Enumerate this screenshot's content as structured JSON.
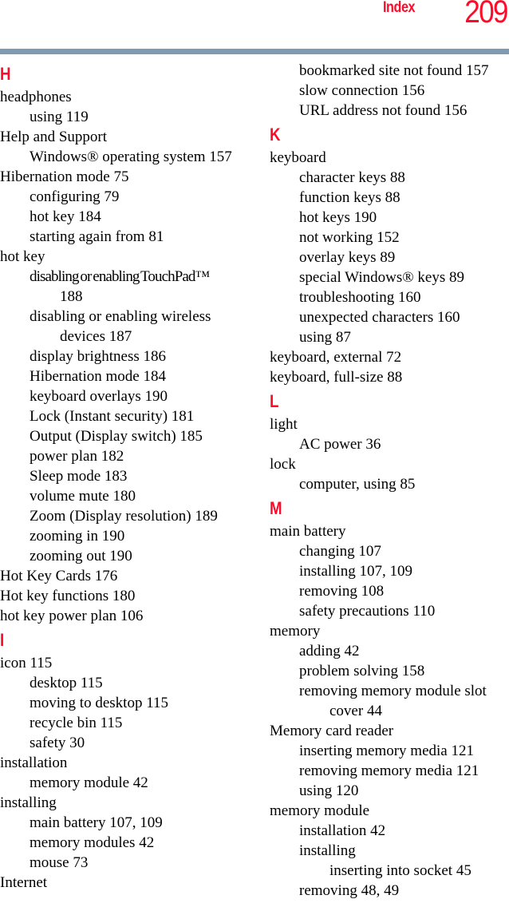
{
  "header": {
    "section": "Index",
    "page_number": "209",
    "rule_color": "#7f9bb4",
    "accent_color": "#ff0a28"
  },
  "columns": [
    {
      "entries": [
        {
          "type": "letter",
          "text": "H"
        },
        {
          "level": 0,
          "text": "headphones"
        },
        {
          "level": 1,
          "text": "using 119"
        },
        {
          "level": 0,
          "text": "Help and Support"
        },
        {
          "level": 1,
          "text": "Windows® operating system 157"
        },
        {
          "level": 0,
          "text": "Hibernation mode 75"
        },
        {
          "level": 1,
          "text": "configuring 79"
        },
        {
          "level": 1,
          "text": "hot key 184"
        },
        {
          "level": 1,
          "text": "starting again from 81"
        },
        {
          "level": 0,
          "text": "hot key"
        },
        {
          "level": 1,
          "text": "disabling or enabling TouchPad™",
          "condensed": true
        },
        {
          "level": 2,
          "text": "188"
        },
        {
          "level": 1,
          "text": "disabling or enabling wireless"
        },
        {
          "level": 2,
          "text": "devices 187"
        },
        {
          "level": 1,
          "text": "display brightness 186"
        },
        {
          "level": 1,
          "text": "Hibernation mode 184"
        },
        {
          "level": 1,
          "text": "keyboard overlays 190"
        },
        {
          "level": 1,
          "text": "Lock (Instant security) 181"
        },
        {
          "level": 1,
          "text": "Output (Display switch) 185"
        },
        {
          "level": 1,
          "text": "power plan 182"
        },
        {
          "level": 1,
          "text": "Sleep mode 183"
        },
        {
          "level": 1,
          "text": "volume mute 180"
        },
        {
          "level": 1,
          "text": "Zoom (Display resolution) 189"
        },
        {
          "level": 1,
          "text": "zooming in 190"
        },
        {
          "level": 1,
          "text": "zooming out 190"
        },
        {
          "level": 0,
          "text": "Hot Key Cards 176"
        },
        {
          "level": 0,
          "text": "Hot key functions 180"
        },
        {
          "level": 0,
          "text": "hot key power plan 106"
        },
        {
          "type": "letter",
          "text": "I"
        },
        {
          "level": 0,
          "text": "icon 115"
        },
        {
          "level": 1,
          "text": "desktop 115"
        },
        {
          "level": 1,
          "text": "moving to desktop 115"
        },
        {
          "level": 1,
          "text": "recycle bin 115"
        },
        {
          "level": 1,
          "text": "safety 30"
        },
        {
          "level": 0,
          "text": "installation"
        },
        {
          "level": 1,
          "text": "memory module 42"
        },
        {
          "level": 0,
          "text": "installing"
        },
        {
          "level": 1,
          "text": "main battery 107, 109"
        },
        {
          "level": 1,
          "text": "memory modules 42"
        },
        {
          "level": 1,
          "text": "mouse 73"
        },
        {
          "level": 0,
          "text": "Internet"
        }
      ]
    },
    {
      "entries": [
        {
          "level": 1,
          "text": "bookmarked site not found 157"
        },
        {
          "level": 1,
          "text": "slow connection 156"
        },
        {
          "level": 1,
          "text": "URL address not found 156"
        },
        {
          "type": "letter",
          "text": "K"
        },
        {
          "level": 0,
          "text": "keyboard"
        },
        {
          "level": 1,
          "text": "character keys 88"
        },
        {
          "level": 1,
          "text": "function keys 88"
        },
        {
          "level": 1,
          "text": "hot keys 190"
        },
        {
          "level": 1,
          "text": "not working 152"
        },
        {
          "level": 1,
          "text": "overlay keys 89"
        },
        {
          "level": 1,
          "text": "special Windows® keys 89"
        },
        {
          "level": 1,
          "text": "troubleshooting 160"
        },
        {
          "level": 1,
          "text": "unexpected characters 160"
        },
        {
          "level": 1,
          "text": "using 87"
        },
        {
          "level": 0,
          "text": "keyboard, external 72"
        },
        {
          "level": 0,
          "text": "keyboard, full-size 88"
        },
        {
          "type": "letter",
          "text": "L"
        },
        {
          "level": 0,
          "text": "light"
        },
        {
          "level": 1,
          "text": "AC power 36"
        },
        {
          "level": 0,
          "text": "lock"
        },
        {
          "level": 1,
          "text": "computer, using 85"
        },
        {
          "type": "letter",
          "text": "M"
        },
        {
          "level": 0,
          "text": "main battery"
        },
        {
          "level": 1,
          "text": "changing 107"
        },
        {
          "level": 1,
          "text": "installing 107, 109"
        },
        {
          "level": 1,
          "text": "removing 108"
        },
        {
          "level": 1,
          "text": "safety precautions 110"
        },
        {
          "level": 0,
          "text": "memory"
        },
        {
          "level": 1,
          "text": "adding 42"
        },
        {
          "level": 1,
          "text": "problem solving 158"
        },
        {
          "level": 1,
          "text": "removing memory module slot"
        },
        {
          "level": 2,
          "text": "cover 44"
        },
        {
          "level": 0,
          "text": "Memory card reader"
        },
        {
          "level": 1,
          "text": "inserting memory media 121"
        },
        {
          "level": 1,
          "text": "removing memory media 121"
        },
        {
          "level": 1,
          "text": "using 120"
        },
        {
          "level": 0,
          "text": "memory module"
        },
        {
          "level": 1,
          "text": "installation 42"
        },
        {
          "level": 1,
          "text": "installing"
        },
        {
          "level": 2,
          "text": "inserting into socket 45"
        },
        {
          "level": 1,
          "text": "removing 48, 49"
        }
      ]
    }
  ]
}
